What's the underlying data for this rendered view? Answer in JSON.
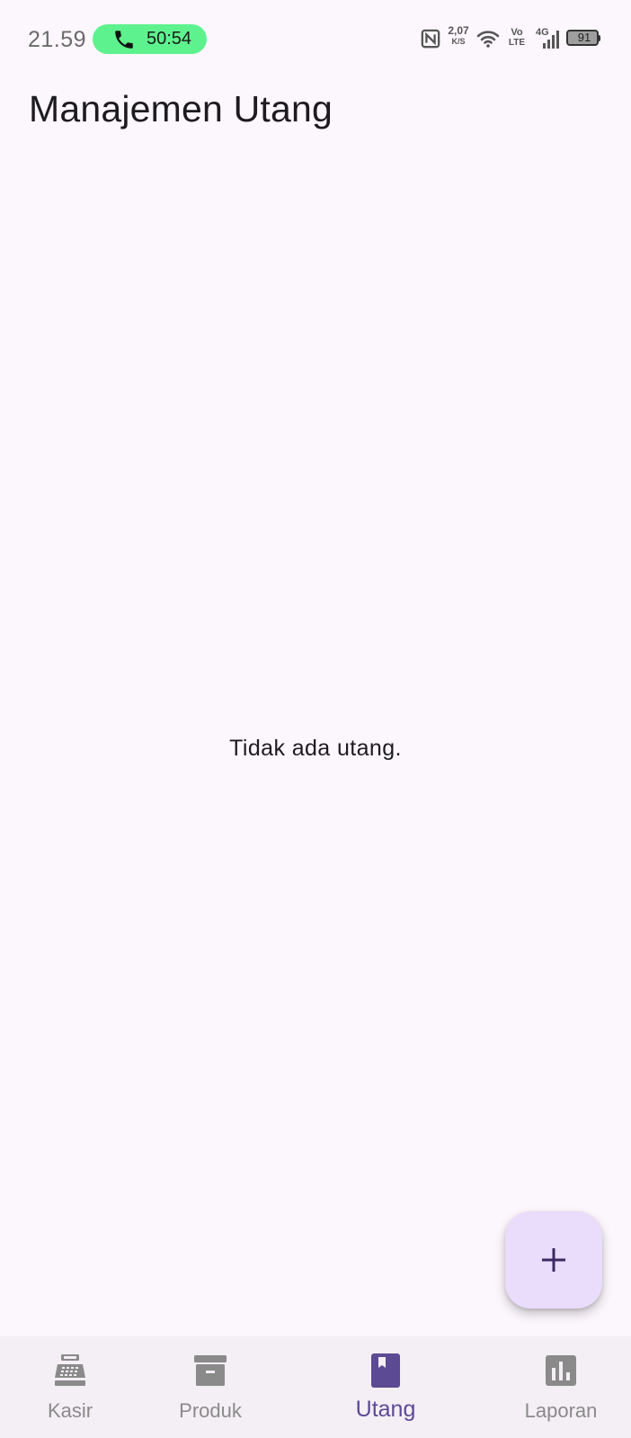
{
  "status_bar": {
    "time": "21.59",
    "call_timer": "50:54",
    "net_speed_value": "2,07",
    "net_speed_unit": "K/S",
    "volte_top": "Vo",
    "volte_bottom": "LTE",
    "network_type": "4G",
    "battery_level": "91",
    "colors": {
      "call_chip": "#5ef28e"
    }
  },
  "app_bar": {
    "title": "Manajemen Utang"
  },
  "main": {
    "empty_message": "Tidak ada utang."
  },
  "fab": {
    "icon": "plus-icon",
    "color": "#eadcfb"
  },
  "bottom_nav": {
    "active_index": 2,
    "active_color": "#5d4a94",
    "items": [
      {
        "label": "Kasir",
        "icon": "cash-register-icon"
      },
      {
        "label": "Produk",
        "icon": "archive-box-icon"
      },
      {
        "label": "Utang",
        "icon": "book-icon"
      },
      {
        "label": "Laporan",
        "icon": "bar-chart-icon"
      }
    ]
  }
}
